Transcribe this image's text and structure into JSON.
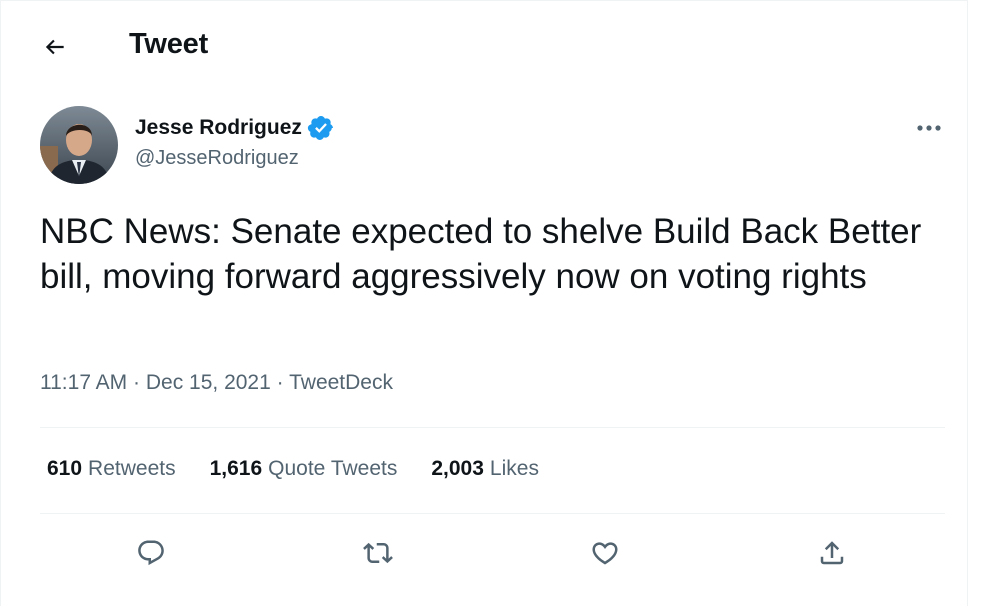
{
  "header": {
    "title": "Tweet",
    "back_icon": "arrow-left-icon"
  },
  "author": {
    "name": "Jesse Rodriguez",
    "handle": "@JesseRodriguez",
    "verified": true,
    "verified_color": "#1d9bf0"
  },
  "tweet": {
    "text": "NBC News: Senate expected to shelve Build Back Better bill, moving forward aggressively now on voting rights",
    "time": "11:17 AM",
    "date": "Dec 15, 2021",
    "source": "TweetDeck",
    "separator": "·"
  },
  "stats": [
    {
      "count": "610",
      "label": "Retweets"
    },
    {
      "count": "1,616",
      "label": "Quote Tweets"
    },
    {
      "count": "2,003",
      "label": "Likes"
    }
  ],
  "actions": [
    "reply-icon",
    "retweet-icon",
    "like-icon",
    "share-icon"
  ],
  "colors": {
    "text": "#0f1419",
    "secondary": "#536471",
    "divider": "#eff3f4",
    "accent": "#1d9bf0"
  }
}
